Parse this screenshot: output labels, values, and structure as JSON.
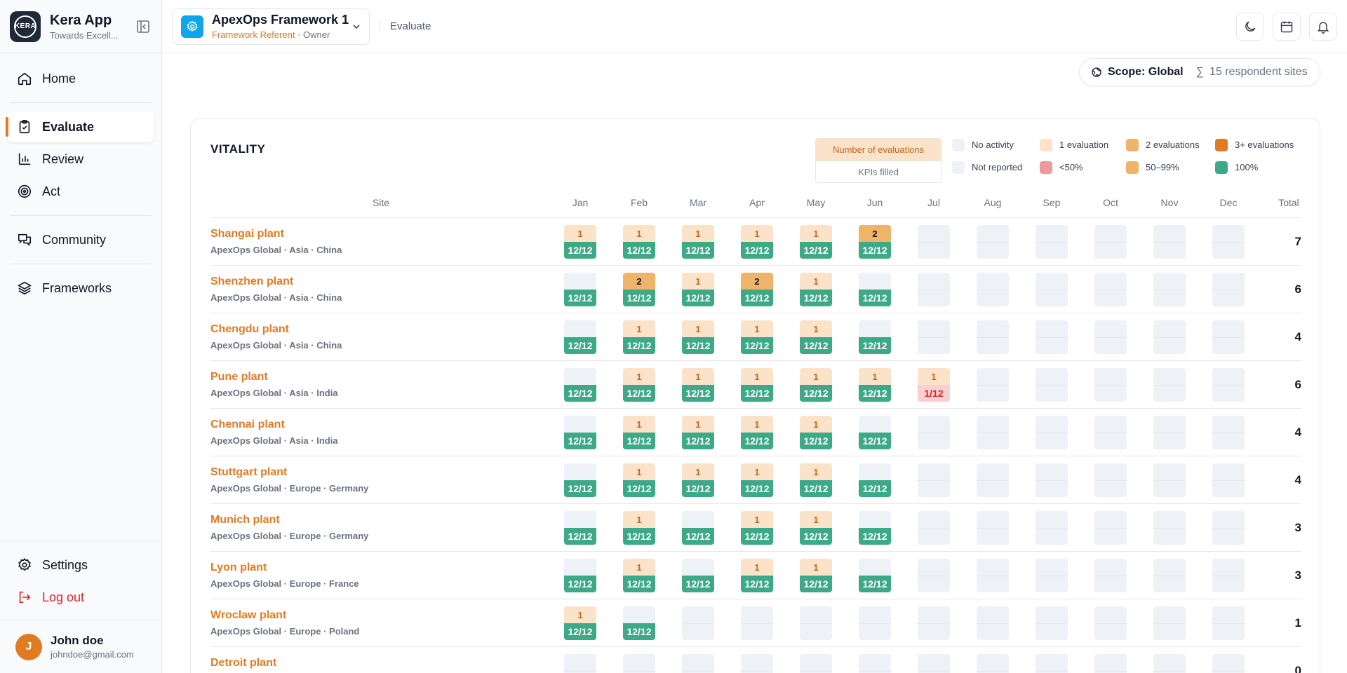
{
  "app": {
    "name": "Kera App",
    "tagline": "Towards Excell...",
    "logo_text": "KERA"
  },
  "nav": {
    "home": "Home",
    "evaluate": "Evaluate",
    "review": "Review",
    "act": "Act",
    "community": "Community",
    "frameworks": "Frameworks",
    "settings": "Settings",
    "logout": "Log out"
  },
  "user": {
    "initial": "J",
    "name": "John doe",
    "email": "johndoe@gmail.com"
  },
  "topbar": {
    "framework_name": "ApexOps Framework 1",
    "framework_role": "Framework Referent",
    "framework_role_suffix": "· Owner",
    "breadcrumb": "Evaluate"
  },
  "scope": {
    "label": "Scope: Global",
    "sigma": "∑",
    "respondents": "15 respondent sites"
  },
  "card": {
    "title": "VITALITY",
    "legend_key_top": "Number of evaluations",
    "legend_key_bottom": "KPIs filled",
    "legend": [
      {
        "label": "No activity",
        "color": "#eef2f7"
      },
      {
        "label": "1 evaluation",
        "color": "#fbe3c9"
      },
      {
        "label": "2 evaluations",
        "color": "#eeb46a"
      },
      {
        "label": "3+ evaluations",
        "color": "#e07b24"
      },
      {
        "label": "Not reported",
        "color": "#eef2f7"
      },
      {
        "label": "<50%",
        "color": "#ee9a9a"
      },
      {
        "label": "50–99%",
        "color": "#eeb46a"
      },
      {
        "label": "100%",
        "color": "#3da987"
      }
    ]
  },
  "columns": {
    "site": "Site",
    "months": [
      "Jan",
      "Feb",
      "Mar",
      "Apr",
      "May",
      "Jun",
      "Jul",
      "Aug",
      "Sep",
      "Oct",
      "Nov",
      "Dec"
    ],
    "total": "Total"
  },
  "colors": {
    "no_activity": "#eef2f7",
    "eval_1": "#fbe3c9",
    "eval_2": "#eeb46a",
    "eval_3": "#e07b24",
    "kpi_full": "#3da987",
    "kpi_low": "#f8d0d0",
    "kpi_low_text": "#dc2626",
    "accent": "#e07b24"
  },
  "rows": [
    {
      "name": "Shangai plant",
      "location": "ApexOps Global · Asia · China",
      "total": "7",
      "evals": [
        "1",
        "1",
        "1",
        "1",
        "1",
        "2",
        "",
        "",
        "",
        "",
        "",
        ""
      ],
      "kpis": [
        "12/12",
        "12/12",
        "12/12",
        "12/12",
        "12/12",
        "12/12",
        "",
        "",
        "",
        "",
        "",
        ""
      ]
    },
    {
      "name": "Shenzhen plant",
      "location": "ApexOps Global · Asia · China",
      "total": "6",
      "evals": [
        "",
        "2",
        "1",
        "2",
        "1",
        "",
        "",
        "",
        "",
        "",
        "",
        ""
      ],
      "kpis": [
        "12/12",
        "12/12",
        "12/12",
        "12/12",
        "12/12",
        "12/12",
        "",
        "",
        "",
        "",
        "",
        ""
      ]
    },
    {
      "name": "Chengdu plant",
      "location": "ApexOps Global · Asia · China",
      "total": "4",
      "evals": [
        "",
        "1",
        "1",
        "1",
        "1",
        "",
        "",
        "",
        "",
        "",
        "",
        ""
      ],
      "kpis": [
        "12/12",
        "12/12",
        "12/12",
        "12/12",
        "12/12",
        "12/12",
        "",
        "",
        "",
        "",
        "",
        ""
      ]
    },
    {
      "name": "Pune plant",
      "location": "ApexOps Global · Asia · India",
      "total": "6",
      "evals": [
        "",
        "1",
        "1",
        "1",
        "1",
        "1",
        "1",
        "",
        "",
        "",
        "",
        ""
      ],
      "kpis": [
        "12/12",
        "12/12",
        "12/12",
        "12/12",
        "12/12",
        "12/12",
        "1/12",
        "",
        "",
        "",
        "",
        ""
      ]
    },
    {
      "name": "Chennai plant",
      "location": "ApexOps Global · Asia · India",
      "total": "4",
      "evals": [
        "",
        "1",
        "1",
        "1",
        "1",
        "",
        "",
        "",
        "",
        "",
        "",
        ""
      ],
      "kpis": [
        "12/12",
        "12/12",
        "12/12",
        "12/12",
        "12/12",
        "12/12",
        "",
        "",
        "",
        "",
        "",
        ""
      ]
    },
    {
      "name": "Stuttgart plant",
      "location": "ApexOps Global · Europe · Germany",
      "total": "4",
      "evals": [
        "",
        "1",
        "1",
        "1",
        "1",
        "",
        "",
        "",
        "",
        "",
        "",
        ""
      ],
      "kpis": [
        "12/12",
        "12/12",
        "12/12",
        "12/12",
        "12/12",
        "12/12",
        "",
        "",
        "",
        "",
        "",
        ""
      ]
    },
    {
      "name": "Munich plant",
      "location": "ApexOps Global · Europe · Germany",
      "total": "3",
      "evals": [
        "",
        "1",
        "",
        "1",
        "1",
        "",
        "",
        "",
        "",
        "",
        "",
        ""
      ],
      "kpis": [
        "12/12",
        "12/12",
        "12/12",
        "12/12",
        "12/12",
        "12/12",
        "",
        "",
        "",
        "",
        "",
        ""
      ]
    },
    {
      "name": "Lyon plant",
      "location": "ApexOps Global · Europe · France",
      "total": "3",
      "evals": [
        "",
        "1",
        "",
        "1",
        "1",
        "",
        "",
        "",
        "",
        "",
        "",
        ""
      ],
      "kpis": [
        "12/12",
        "12/12",
        "12/12",
        "12/12",
        "12/12",
        "12/12",
        "",
        "",
        "",
        "",
        "",
        ""
      ]
    },
    {
      "name": "Wroclaw plant",
      "location": "ApexOps Global · Europe · Poland",
      "total": "1",
      "evals": [
        "1",
        "",
        "",
        "",
        "",
        "",
        "",
        "",
        "",
        "",
        "",
        ""
      ],
      "kpis": [
        "12/12",
        "12/12",
        "",
        "",
        "",
        "",
        "",
        "",
        "",
        "",
        "",
        ""
      ]
    },
    {
      "name": "Detroit plant",
      "location": "",
      "total": "0",
      "evals": [
        "",
        "",
        "",
        "",
        "",
        "",
        "",
        "",
        "",
        "",
        "",
        ""
      ],
      "kpis": [
        "",
        "",
        "",
        "",
        "",
        "",
        "",
        "",
        "",
        "",
        "",
        ""
      ]
    }
  ]
}
